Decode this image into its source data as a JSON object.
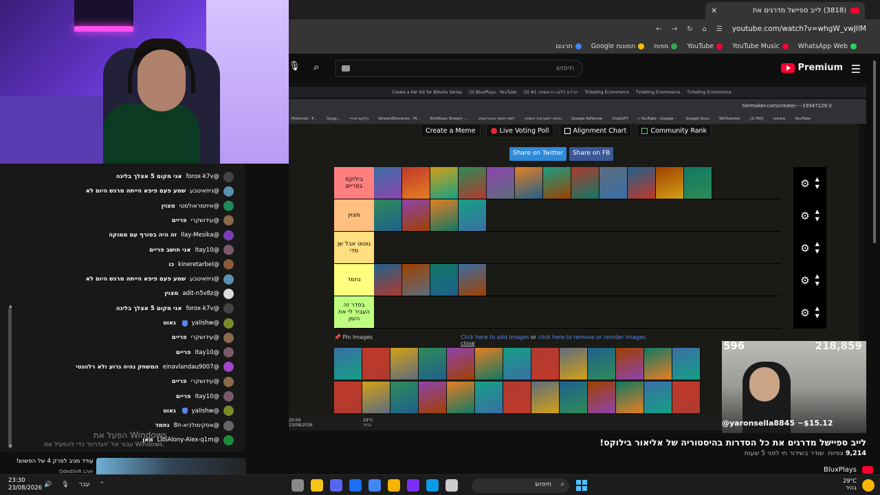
{
  "browser": {
    "tab_title": "(3818) לייב ספיישל מדרגים את",
    "url": "youtube.com/watch?v=whgW_vwJIlM",
    "bookmarks": [
      {
        "label": "WhatsApp Web",
        "color": "#25d366"
      },
      {
        "label": "YouTube Music",
        "color": "#ff0033"
      },
      {
        "label": "YouTube",
        "color": "#ff0033"
      },
      {
        "label": "מפות",
        "color": "#34a853"
      },
      {
        "label": "תמונות Google",
        "color": "#fbbc05"
      },
      {
        "label": "תרגום",
        "color": "#4285f4"
      }
    ]
  },
  "youtube": {
    "brand": "Premium",
    "search_placeholder": "חיפוש",
    "video_title": "לייב ספיישל מדרגים את כל הסדרות בהיסטוריה של אליאור בילוקס!",
    "views": "9,214",
    "views_label": "צפיות",
    "stream_meta": "שודר בשידור חי לפני 5 שעות",
    "channel": "BluxPlays"
  },
  "stream": {
    "inner_tabs": [
      "Create a tier list for Bilocks Series",
      "(3) BluxPlays - YouTube",
      "(3) הדירוג לליגה הראשונה #1",
      "Ticketing Ecommerce",
      "Ticketing Ecommerce",
      "Ticketing Ecommerce"
    ],
    "inner_url": "tiermaker.com/create/----19347129-2",
    "inner_bookmarks": [
      "Potential - F...",
      "Goog...",
      "בלוקס פרויי",
      "StreamElements - M...",
      "ElorBlues Stream -...",
      "לסטריממס אינטרקטיב",
      "כניסה לשערוכת הוסחה",
      "Google AdSense",
      "ChatGPT",
      "יו YouTube - Google -",
      "Google Docs",
      "WeTransfer",
      "(3,760)",
      "משימות",
      "YouTube"
    ],
    "buttons": {
      "meme": "Create a Meme",
      "poll": "Live Voting Poll",
      "alignment": "Alignment Chart",
      "community": "Community Rank",
      "twitter": "Share on Twitter",
      "fb": "Share on FB"
    },
    "tiers": [
      {
        "label": "בילוקס בפריים",
        "color": "#ff7f7f",
        "count": 12
      },
      {
        "label": "מצוין",
        "color": "#ffbf7f",
        "count": 4
      },
      {
        "label": "גוטוט אבל שן מדי",
        "color": "#ffdf7f",
        "count": 0
      },
      {
        "label": "נחמד",
        "color": "#ffff7f",
        "count": 4
      },
      {
        "label": "בסדר זה העביר לי את הזמן",
        "color": "#bfff7f",
        "count": 0
      }
    ],
    "pin_label": "Pin Images",
    "pin_link1": "Click here to add images",
    "pin_or": "or",
    "pin_link2": "click here to remove or reorder images.",
    "pin_close": "close",
    "inner_time": "20:09",
    "inner_date": "23/08/2026",
    "inner_temp": "29°C",
    "inner_weather": "בהיר",
    "cam_number_1": "596",
    "cam_number_2": "218,859",
    "cam_handle": "@yaronsella8845 ~$15.12"
  },
  "chat": {
    "messages": [
      {
        "user": "@forox-k7v",
        "text": "אני מקום 5 אצלך בליגה",
        "avatar": "#444"
      },
      {
        "user": "@ניתאיטבע",
        "text": "שמע פעם פיפא הייתה מרגש היום לא",
        "avatar": "#5b8fb0"
      },
      {
        "user": "@איתמראולמטי",
        "text": "מצוין",
        "avatar": "#1f8a5a"
      },
      {
        "user": "@עידושקרי",
        "text": "פריים",
        "avatar": "#8a6a4a"
      },
      {
        "user": "@Ilay-Mesika",
        "text": "זה היה בסורף עם ממוקה",
        "avatar": "#7a3fb5"
      },
      {
        "user": "@Itay10",
        "text": "אני חושב פריים",
        "avatar": "#7a5a6a"
      },
      {
        "user": "@kineretarbel",
        "text": "כו",
        "avatar": "#8a5a3a"
      },
      {
        "user": "@ניתאיטבע",
        "text": "שמע פעם פיפא הייתה מרגש היום לא",
        "avatar": "#5b8fb0"
      },
      {
        "user": "@adit-n5v8z",
        "text": "מצוין",
        "avatar": "#ddd"
      },
      {
        "user": "@forox-k7v",
        "text": "אני מקום 5 אצלך בליגה",
        "avatar": "#444"
      },
      {
        "user": "@yalishw",
        "text": "גאוט",
        "avatar": "#7a8a2a",
        "member": true
      },
      {
        "user": "@עידושקרי",
        "text": "פריים",
        "avatar": "#8a6a4a"
      },
      {
        "user": "@Itay10",
        "text": "פריים",
        "avatar": "#7a5a6a"
      },
      {
        "user": "@einavlandau9007",
        "text": "המשחק נהיה גרוע ולא רלוונטי",
        "avatar": "#a046c8"
      },
      {
        "user": "@עידושקרי",
        "text": "פריים",
        "avatar": "#8a6a4a"
      },
      {
        "user": "@Itay10",
        "text": "פריים",
        "avatar": "#7a5a6a"
      },
      {
        "user": "@yalishw",
        "text": "גאוט",
        "avatar": "#7a8a2a",
        "member": true
      },
      {
        "user": "@אסקימולכיא-8n",
        "text": "נחמד",
        "avatar": "#666"
      },
      {
        "user": "@LibiAlony-Alex-q1m",
        "text": "מאן",
        "avatar": "#1f8a3a"
      }
    ],
    "watermark": "הפעל את Windows",
    "watermark_sub": "עבור אל 'הגדרות' כדי להפעיל את Windows.",
    "next_title": "עודד מגיב לפרק 4 של הפשוש!",
    "next_channel": "OdedSVR Live"
  },
  "taskbar": {
    "time": "23:30",
    "date": "23/08/2026",
    "lang": "עבר",
    "search": "חיפוש",
    "temp": "29°C",
    "weather": "בהיר",
    "apps": [
      "#888",
      "#f5c518",
      "#5865f2",
      "#1c6ef2",
      "#4285f4",
      "#f5b400",
      "#7b2ff7",
      "#0b9be6",
      "#cccccc"
    ]
  }
}
